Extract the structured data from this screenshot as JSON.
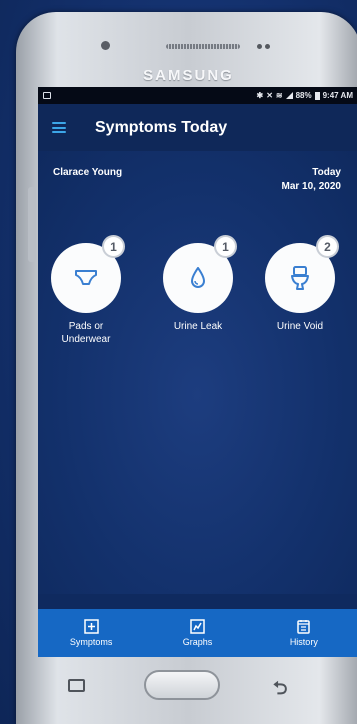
{
  "device": {
    "brand": "SAMSUNG"
  },
  "status_bar": {
    "battery": "88%",
    "time": "9:47 AM"
  },
  "app_bar": {
    "title": "Symptoms Today"
  },
  "user": {
    "name": "Clarace Young"
  },
  "date": {
    "label": "Today",
    "value": "Mar 10, 2020"
  },
  "symptoms": [
    {
      "label": "Pads or Underwear",
      "count": "1",
      "icon": "pad-underwear-icon"
    },
    {
      "label": "Urine Leak",
      "count": "1",
      "icon": "droplet-icon"
    },
    {
      "label": "Urine Void",
      "count": "2",
      "icon": "toilet-icon"
    }
  ],
  "bottom_nav": [
    {
      "label": "Symptoms",
      "icon": "plus-square-icon"
    },
    {
      "label": "Graphs",
      "icon": "graph-icon"
    },
    {
      "label": "History",
      "icon": "calendar-list-icon"
    }
  ],
  "colors": {
    "screen_bg": "#0f2a5f",
    "nav_bg": "#1668c4",
    "menu_accent": "#3ca6e8"
  }
}
